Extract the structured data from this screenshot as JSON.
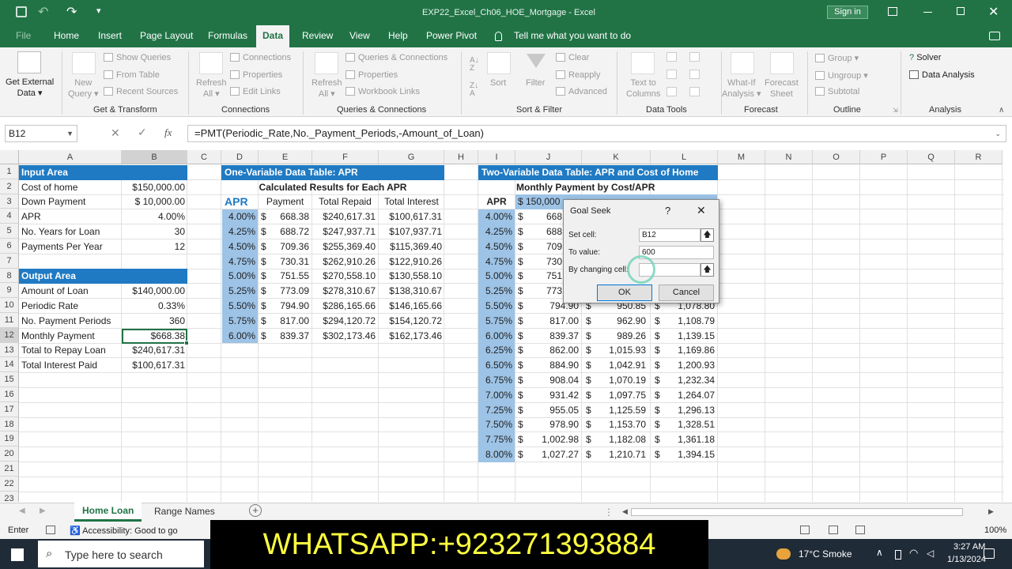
{
  "titlebar": {
    "filename": "EXP22_Excel_Ch06_HOE_Mortgage",
    "sep": "-",
    "app": "Excel",
    "signin": "Sign in"
  },
  "tabs": {
    "file": "File",
    "home": "Home",
    "insert": "Insert",
    "page_layout": "Page Layout",
    "formulas": "Formulas",
    "data": "Data",
    "review": "Review",
    "view": "View",
    "help": "Help",
    "power_pivot": "Power Pivot",
    "tell_me": "Tell me what you want to do"
  },
  "ribbon": {
    "get_external": "Get External",
    "data": "Data",
    "new": "New",
    "query": "Query",
    "show_queries": "Show Queries",
    "from_table": "From Table",
    "recent_sources": "Recent Sources",
    "group_gt": "Get & Transform",
    "refresh": "Refresh",
    "all": "All",
    "connections_btn": "Connections",
    "properties": "Properties",
    "edit_links": "Edit Links",
    "group_conn": "Connections",
    "queries_connections": "Queries & Connections",
    "properties2": "Properties",
    "workbook_links": "Workbook Links",
    "group_qc": "Queries & Connections",
    "sort": "Sort",
    "filter": "Filter",
    "clear": "Clear",
    "reapply": "Reapply",
    "advanced": "Advanced",
    "group_sf": "Sort & Filter",
    "text_to": "Text to",
    "columns": "Columns",
    "group_dt": "Data Tools",
    "what_if": "What-If",
    "analysis": "Analysis",
    "forecast": "Forecast",
    "sheet": "Sheet",
    "group_fc": "Forecast",
    "group_btn": "Group",
    "ungroup": "Ungroup",
    "subtotal": "Subtotal",
    "group_ol": "Outline",
    "solver": "Solver",
    "data_analysis": "Data Analysis",
    "group_an": "Analysis"
  },
  "formula_bar": {
    "namebox": "B12",
    "fx": "fx",
    "formula": "=PMT(Periodic_Rate,No._Payment_Periods,-Amount_of_Loan)"
  },
  "columns": [
    "A",
    "B",
    "C",
    "D",
    "E",
    "F",
    "G",
    "H",
    "I",
    "J",
    "K",
    "L",
    "M",
    "N",
    "O",
    "P",
    "Q",
    "R"
  ],
  "rows": [
    "1",
    "2",
    "3",
    "4",
    "5",
    "6",
    "7",
    "8",
    "9",
    "10",
    "11",
    "12",
    "13",
    "14",
    "15",
    "16",
    "17",
    "18",
    "19",
    "20",
    "21",
    "22",
    "23"
  ],
  "input": {
    "title": "Input Area",
    "labels": [
      "Cost of home",
      "Down Payment",
      "APR",
      "No. Years for Loan",
      "Payments Per Year"
    ],
    "values": [
      "$150,000.00",
      "$  10,000.00",
      "4.00%",
      "30",
      "12"
    ]
  },
  "output": {
    "title": "Output Area",
    "labels": [
      "Amount of Loan",
      "Periodic Rate",
      "No. Payment Periods",
      "Monthly Payment",
      "Total to Repay Loan",
      "Total Interest Paid"
    ],
    "values": [
      "$140,000.00",
      "0.33%",
      "360",
      "$668.38",
      "$240,617.31",
      "$100,617.31"
    ]
  },
  "table1": {
    "title": "One-Variable Data Table: APR",
    "subtitle": "Calculated Results for Each APR",
    "headers": [
      "APR",
      "Payment",
      "Total Repaid",
      "Total Interest"
    ],
    "apr": [
      "4.00%",
      "4.25%",
      "4.50%",
      "4.75%",
      "5.00%",
      "5.25%",
      "5.50%",
      "5.75%",
      "6.00%"
    ],
    "payment": [
      "668.38",
      "688.72",
      "709.36",
      "730.31",
      "751.55",
      "773.09",
      "794.90",
      "817.00",
      "839.37"
    ],
    "repaid": [
      "$240,617.31",
      "$247,937.71",
      "$255,369.40",
      "$262,910.26",
      "$270,558.10",
      "$278,310.67",
      "$286,165.66",
      "$294,120.72",
      "$302,173.46"
    ],
    "interest": [
      "$100,617.31",
      "$107,937.71",
      "$115,369.40",
      "$122,910.26",
      "$130,558.10",
      "$138,310.67",
      "$146,165.66",
      "$154,120.72",
      "$162,173.46"
    ]
  },
  "table2": {
    "title": "Two-Variable Data Table: APR and Cost of Home",
    "subtitle": "Monthly Payment by Cost/APR",
    "apr_label": "APR",
    "j3": "$ 150,000",
    "apr": [
      "4.00%",
      "4.25%",
      "4.50%",
      "4.75%",
      "5.00%",
      "5.25%",
      "5.50%",
      "5.75%",
      "6.00%",
      "6.25%",
      "6.50%",
      "6.75%",
      "7.00%",
      "7.25%",
      "7.50%",
      "7.75%",
      "8.00%"
    ],
    "j": [
      "668",
      "688",
      "709",
      "730",
      "751",
      "773",
      "794.90",
      "817.00",
      "839.37",
      "862.00",
      "884.90",
      "908.04",
      "931.42",
      "955.05",
      "978.90",
      "1,002.98",
      "1,027.27"
    ],
    "k": [
      "",
      "",
      "",
      "",
      "",
      "",
      "950.85",
      "962.90",
      "989.26",
      "1,015.93",
      "1,042.91",
      "1,070.19",
      "1,097.75",
      "1,125.59",
      "1,153.70",
      "1,182.08",
      "1,210.71"
    ],
    "l": [
      "",
      "",
      "",
      "",
      "",
      "",
      "1,078.80",
      "1,108.79",
      "1,139.15",
      "1,169.86",
      "1,200.93",
      "1,232.34",
      "1,264.07",
      "1,296.13",
      "1,328.51",
      "1,361.18",
      "1,394.15"
    ],
    "dollar": "$"
  },
  "dialog": {
    "title": "Goal Seek",
    "help": "?",
    "close": "✕",
    "set_cell_label": "Set cell:",
    "set_cell": "B12",
    "to_value_label": "To value:",
    "to_value": "600",
    "by_changing_label": "By changing cell:",
    "by_changing": "",
    "ok": "OK",
    "cancel": "Cancel"
  },
  "sheets": {
    "active": "Home Loan",
    "other": "Range Names",
    "add": "+"
  },
  "status": {
    "mode": "Enter",
    "accessibility": "Accessibility: Good to go",
    "zoom": "100%"
  },
  "taskbar": {
    "search": "Type here to search",
    "weather": "17°C  Smoke",
    "time": "3:27 AM",
    "date": "1/13/2024"
  },
  "overlay": {
    "whatsapp": "WHATSAPP:+923271393884"
  }
}
